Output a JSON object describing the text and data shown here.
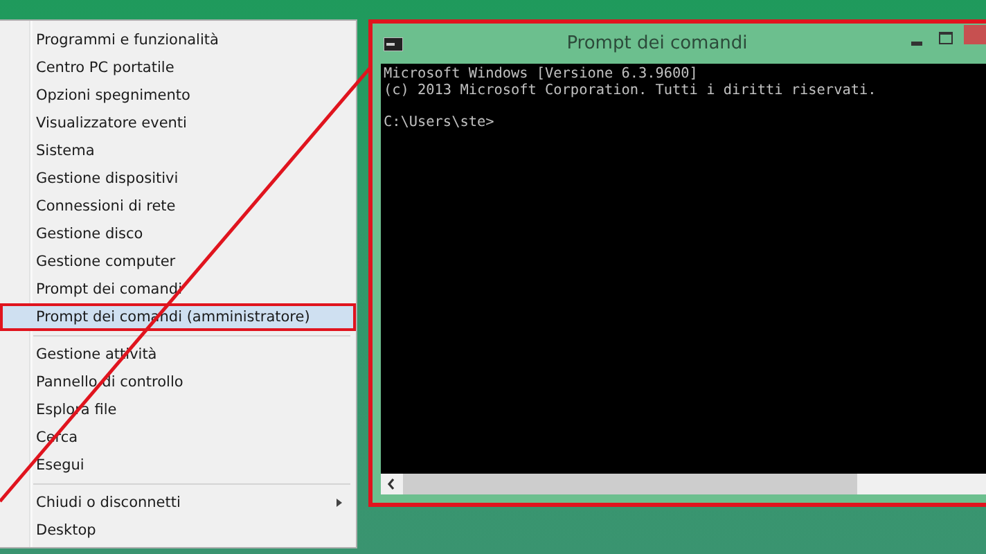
{
  "menu": {
    "groups": [
      {
        "items": [
          {
            "label": "Programmi e funzionalità",
            "selected": false,
            "kind": "plain"
          },
          {
            "label": "Centro PC portatile",
            "selected": false,
            "kind": "plain"
          },
          {
            "label": "Opzioni spegnimento",
            "selected": false,
            "kind": "plain"
          },
          {
            "label": "Visualizzatore eventi",
            "selected": false,
            "kind": "plain"
          },
          {
            "label": "Sistema",
            "selected": false,
            "kind": "plain"
          },
          {
            "label": "Gestione dispositivi",
            "selected": false,
            "kind": "plain"
          },
          {
            "label": "Connessioni di rete",
            "selected": false,
            "kind": "plain"
          },
          {
            "label": "Gestione disco",
            "selected": false,
            "kind": "plain"
          },
          {
            "label": "Gestione computer",
            "selected": false,
            "kind": "plain"
          },
          {
            "label": "Prompt dei comandi",
            "selected": false,
            "kind": "plain"
          },
          {
            "label": "Prompt dei comandi (amministratore)",
            "selected": true,
            "kind": "plain"
          }
        ]
      },
      {
        "items": [
          {
            "label": "Gestione attività",
            "selected": false,
            "kind": "plain"
          },
          {
            "label": "Pannello di controllo",
            "selected": false,
            "kind": "plain"
          },
          {
            "label": "Esplora file",
            "selected": false,
            "kind": "plain"
          },
          {
            "label": "Cerca",
            "selected": false,
            "kind": "plain"
          },
          {
            "label": "Esegui",
            "selected": false,
            "kind": "plain"
          }
        ]
      },
      {
        "items": [
          {
            "label": "Chiudi o disconnetti",
            "selected": false,
            "kind": "submenu"
          },
          {
            "label": "Desktop",
            "selected": false,
            "kind": "plain"
          }
        ]
      }
    ]
  },
  "console": {
    "title": "Prompt dei comandi",
    "blocks": [
      {
        "lines": [
          "Microsoft Windows [Versione 6.3.9600]",
          "(c) 2013 Microsoft Corporation. Tutti i diritti riservati."
        ]
      },
      {
        "lines": [
          "C:\\Users\\ste>"
        ]
      }
    ]
  }
}
